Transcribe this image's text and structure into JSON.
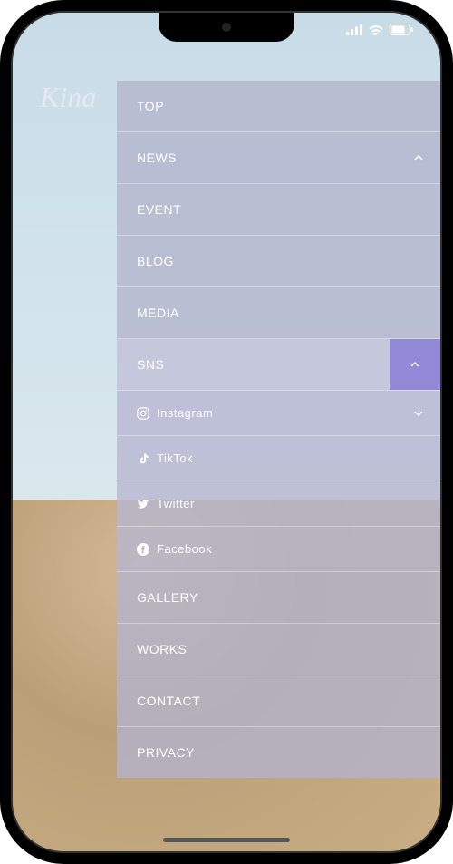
{
  "logo": "Kina",
  "menu": {
    "top": "TOP",
    "news": "NEWS",
    "event": "EVENT",
    "blog": "BLOG",
    "media": "MEDIA",
    "sns": "SNS",
    "instagram": "Instagram",
    "tiktok": "TikTok",
    "twitter": "Twitter",
    "facebook": "Facebook",
    "gallery": "GALLERY",
    "works": "WORKS",
    "contact": "CONTACT",
    "privacy": "PRIVACY"
  }
}
